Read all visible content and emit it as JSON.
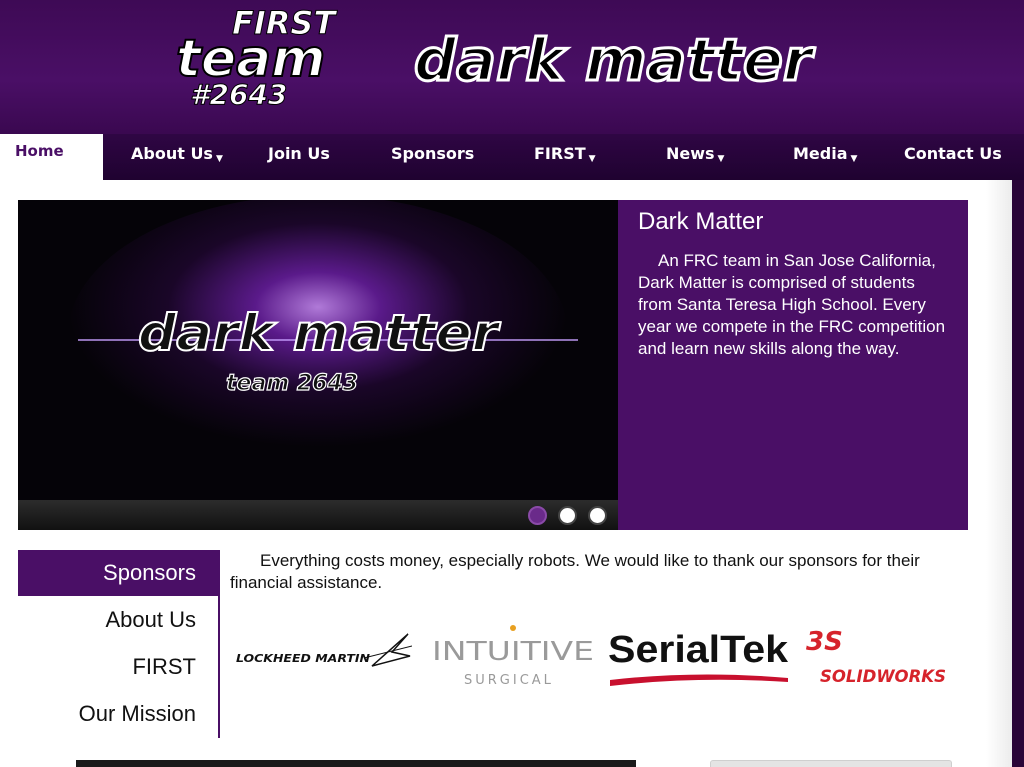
{
  "header": {
    "logo_first_word": "FIRST",
    "logo_team_word": "team",
    "logo_team_number": "#2643",
    "logo_team_name": "dark matter"
  },
  "nav": {
    "items": [
      {
        "label": "Home",
        "active": true,
        "has_dropdown": false
      },
      {
        "label": "About Us",
        "has_dropdown": true
      },
      {
        "label": "Join Us",
        "has_dropdown": false
      },
      {
        "label": "Sponsors",
        "has_dropdown": false
      },
      {
        "label": "FIRST",
        "has_dropdown": true
      },
      {
        "label": "News",
        "has_dropdown": true
      },
      {
        "label": "Media",
        "has_dropdown": true
      },
      {
        "label": "Contact Us",
        "has_dropdown": false
      }
    ]
  },
  "hero": {
    "image_text": "dark matter",
    "image_subtext": "team 2643",
    "title": "Dark Matter",
    "description": "An FRC team in San Jose California, Dark Matter is comprised of students from Santa Teresa High School. Every year we compete in the FRC competition and learn new skills along the way.",
    "slides": [
      {
        "active": true
      },
      {
        "active": false
      },
      {
        "active": false
      }
    ]
  },
  "sidebar": {
    "items": [
      {
        "label": "Sponsors",
        "active": true
      },
      {
        "label": "About Us"
      },
      {
        "label": "FIRST"
      },
      {
        "label": "Our Mission"
      }
    ]
  },
  "content": {
    "text": "Everything costs money, especially robots. We would like to thank our sponsors for their financial assistance."
  },
  "sponsors": [
    {
      "name": "LOCKHEED MARTIN"
    },
    {
      "name": "INTUITIVE",
      "sub": "SURGICAL"
    },
    {
      "name": "SerialTek"
    },
    {
      "name": "SOLIDWORKS"
    }
  ],
  "colors": {
    "brand_purple": "#4a0f66",
    "nav_dark": "#1f0230",
    "serialtek_red": "#c8102e",
    "solidworks_red": "#d6232b"
  }
}
